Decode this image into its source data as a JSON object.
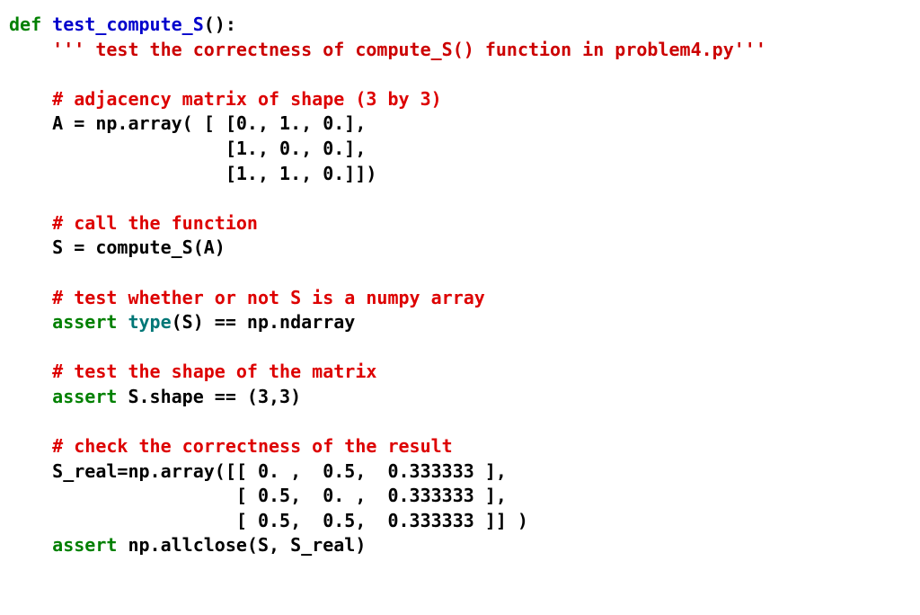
{
  "code": {
    "def": "def",
    "fname": "test_compute_S",
    "sig_tail": "():",
    "doc_q1": "'''",
    "doc_body": " test the correctness of compute_S() function in problem4.py",
    "doc_q2": "'''",
    "c1": "# adjacency matrix of shape (3 by 3)",
    "l_arr1": "A = np.array( [ [0., 1., 0.],",
    "l_arr2": "                [1., 0., 0.],",
    "l_arr3": "                [1., 1., 0.]])",
    "c2": "# call the function",
    "l_call": "S = compute_S(A)",
    "c3": "# test whether or not S is a numpy array",
    "assert1a": "assert",
    "assert1_mid": " ",
    "type_kw": "type",
    "assert1_tail": "(S) == np.ndarray",
    "c4": "# test the shape of the matrix",
    "assert2a": "assert",
    "assert2_tail": " S.shape == (3,3)",
    "c5": "# check the correctness of the result",
    "l_sr1": "S_real=np.array([[ 0. ,  0.5,  0.333333 ],",
    "l_sr2": "                 [ 0.5,  0. ,  0.333333 ],",
    "l_sr3": "                 [ 0.5,  0.5,  0.333333 ]] )",
    "assert3a": "assert",
    "assert3_tail": " np.allclose(S, S_real)"
  }
}
